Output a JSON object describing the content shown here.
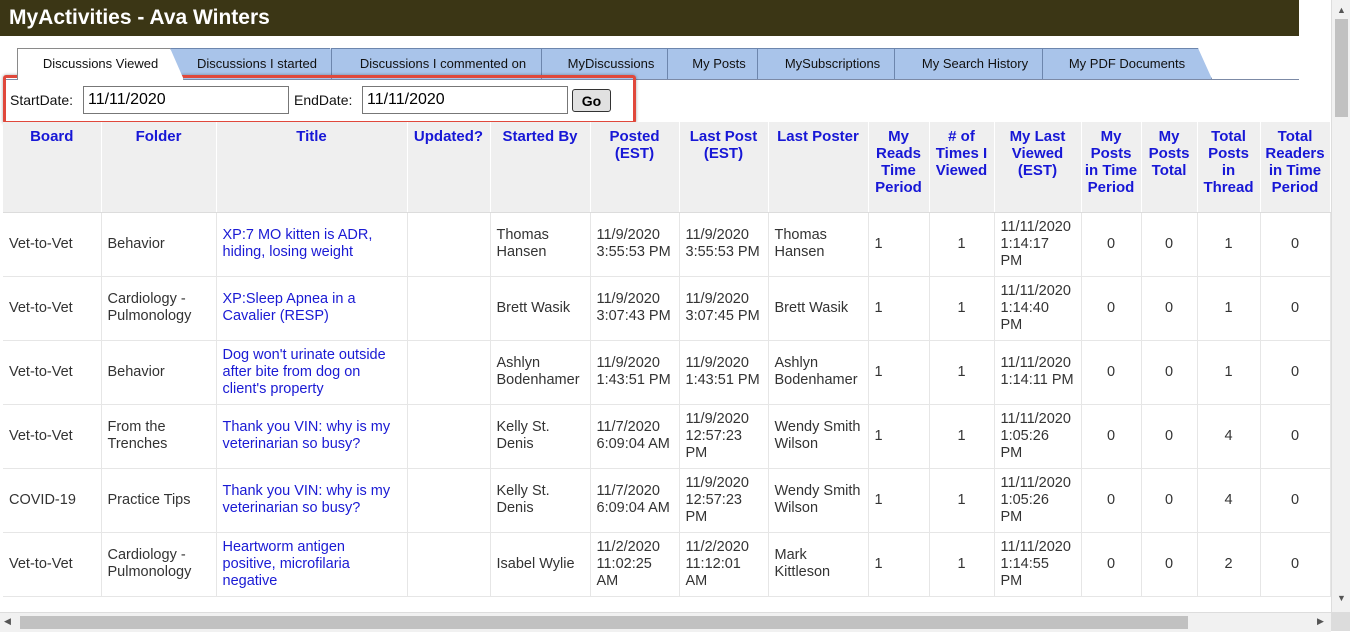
{
  "header": {
    "title": "MyActivities - Ava Winters"
  },
  "tabs": [
    {
      "label": "Discussions Viewed",
      "active": true
    },
    {
      "label": "Discussions I started",
      "active": false
    },
    {
      "label": "Discussions I commented on",
      "active": false
    },
    {
      "label": "MyDiscussions",
      "active": false
    },
    {
      "label": "My Posts",
      "active": false
    },
    {
      "label": "MySubscriptions",
      "active": false
    },
    {
      "label": "My Search History",
      "active": false
    },
    {
      "label": "My PDF Documents",
      "active": false
    }
  ],
  "filter": {
    "start_label": "StartDate:",
    "start_value": "11/11/2020",
    "end_label": "EndDate:",
    "end_value": "11/11/2020",
    "go_label": "Go"
  },
  "table": {
    "headers": [
      "Board",
      "Folder",
      "Title",
      "Updated?",
      "Started By",
      "Posted (EST)",
      "Last Post (EST)",
      "Last Poster",
      "My Reads Time Period",
      "# of Times I Viewed",
      "My Last Viewed (EST)",
      "My Posts in Time Period",
      "My Posts Total",
      "Total Posts in Thread",
      "Total Readers in Time Period"
    ],
    "rows": [
      [
        "Vet-to-Vet",
        "Behavior",
        "XP:7 MO kitten is ADR, hiding, losing weight",
        "",
        "Thomas Hansen",
        "11/9/2020 3:55:53 PM",
        "11/9/2020 3:55:53 PM",
        "Thomas Hansen",
        "1",
        "1",
        "11/11/2020 1:14:17 PM",
        "0",
        "0",
        "1",
        "0"
      ],
      [
        "Vet-to-Vet",
        "Cardiology - Pulmonology",
        "XP:Sleep Apnea in a Cavalier (RESP)",
        "",
        "Brett Wasik",
        "11/9/2020 3:07:43 PM",
        "11/9/2020 3:07:45 PM",
        "Brett Wasik",
        "1",
        "1",
        "11/11/2020 1:14:40 PM",
        "0",
        "0",
        "1",
        "0"
      ],
      [
        "Vet-to-Vet",
        "Behavior",
        "Dog won't urinate outside after bite from dog on client's property",
        "",
        "Ashlyn Bodenhamer",
        "11/9/2020 1:43:51 PM",
        "11/9/2020 1:43:51 PM",
        "Ashlyn Bodenhamer",
        "1",
        "1",
        "11/11/2020 1:14:11 PM",
        "0",
        "0",
        "1",
        "0"
      ],
      [
        "Vet-to-Vet",
        "From the Trenches",
        "Thank you VIN: why is my veterinarian so busy?",
        "",
        "Kelly St. Denis",
        "11/7/2020 6:09:04 AM",
        "11/9/2020 12:57:23 PM",
        "Wendy Smith Wilson",
        "1",
        "1",
        "11/11/2020 1:05:26 PM",
        "0",
        "0",
        "4",
        "0"
      ],
      [
        "COVID-19",
        "Practice Tips",
        "Thank you VIN: why is my veterinarian so busy?",
        "",
        "Kelly St. Denis",
        "11/7/2020 6:09:04 AM",
        "11/9/2020 12:57:23 PM",
        "Wendy Smith Wilson",
        "1",
        "1",
        "11/11/2020 1:05:26 PM",
        "0",
        "0",
        "4",
        "0"
      ],
      [
        "Vet-to-Vet",
        "Cardiology - Pulmonology",
        "Heartworm antigen positive, microfilaria negative",
        "",
        "Isabel Wylie",
        "11/2/2020 11:02:25 AM",
        "11/2/2020 11:12:01 AM",
        "Mark Kittleson",
        "1",
        "1",
        "11/11/2020 1:14:55 PM",
        "0",
        "0",
        "2",
        "0"
      ]
    ]
  }
}
